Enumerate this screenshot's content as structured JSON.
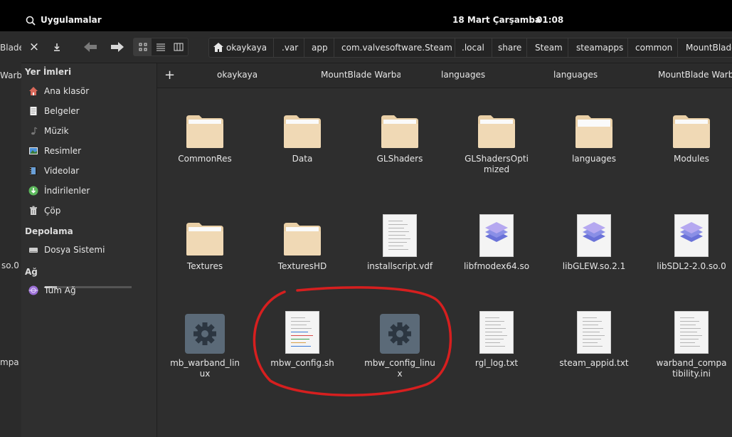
{
  "topbar": {
    "apps_label": "Uygulamalar",
    "date": "18 Mart Çarşamba",
    "time": "01:08"
  },
  "background_window": {
    "texts": [
      "Blade",
      "Warba",
      "so.0",
      "mpa"
    ]
  },
  "toolbar": {
    "close": "×",
    "download": "⤓",
    "back": "←",
    "forward": "→"
  },
  "view_modes": [
    {
      "name": "icon-view",
      "active": true
    },
    {
      "name": "list-view",
      "active": false
    },
    {
      "name": "column-view",
      "active": false
    }
  ],
  "breadcrumbs": [
    "okaykaya",
    ".var",
    "app",
    "com.valvesoftware.Steam",
    ".local",
    "share",
    "Steam",
    "steamapps",
    "common",
    "MountBlade"
  ],
  "sidebar": {
    "places_header": "Yer İmleri",
    "places": [
      {
        "label": "Ana klasör",
        "icon": "home-icon"
      },
      {
        "label": "Belgeler",
        "icon": "document-icon"
      },
      {
        "label": "Müzik",
        "icon": "music-icon"
      },
      {
        "label": "Resimler",
        "icon": "pictures-icon"
      },
      {
        "label": "Videolar",
        "icon": "video-icon"
      },
      {
        "label": "İndirilenler",
        "icon": "download-icon"
      },
      {
        "label": "Çöp",
        "icon": "trash-icon"
      }
    ],
    "storage_header": "Depolama",
    "storage": [
      {
        "label": "Dosya Sistemi",
        "icon": "drive-icon",
        "usage_percent": 14
      }
    ],
    "network_header": "Ağ",
    "network": [
      {
        "label": "Tüm Ağ",
        "icon": "network-icon"
      }
    ]
  },
  "tabs": [
    "okaykaya",
    "MountBlade Warbar",
    "languages",
    "languages",
    "MountBlade Warba"
  ],
  "files": [
    {
      "name": "CommonRes",
      "type": "folder"
    },
    {
      "name": "Data",
      "type": "folder"
    },
    {
      "name": "GLShaders",
      "type": "folder"
    },
    {
      "name": "GLShadersOpti\nmized",
      "type": "folder"
    },
    {
      "name": "languages",
      "type": "folder-open"
    },
    {
      "name": "Modules",
      "type": "folder"
    },
    {
      "name": "Textures",
      "type": "folder"
    },
    {
      "name": "TexturesHD",
      "type": "folder"
    },
    {
      "name": "installscript.vdf",
      "type": "text"
    },
    {
      "name": "libfmodex64.so",
      "type": "library"
    },
    {
      "name": "libGLEW.so.2.1",
      "type": "library"
    },
    {
      "name": "libSDL2-2.0.so.0",
      "type": "library"
    },
    {
      "name": "mb_warband_lin\nux",
      "type": "executable"
    },
    {
      "name": "mbw_config.sh",
      "type": "script"
    },
    {
      "name": "mbw_config_linu\nx",
      "type": "executable"
    },
    {
      "name": "rgl_log.txt",
      "type": "text"
    },
    {
      "name": "steam_appid.txt",
      "type": "text"
    },
    {
      "name": "warband_compa\ntibility.ini",
      "type": "text"
    }
  ],
  "colors": {
    "annotation": "#d61f1f",
    "accent": "#3b8eea",
    "folder": "#f0d9b5"
  }
}
